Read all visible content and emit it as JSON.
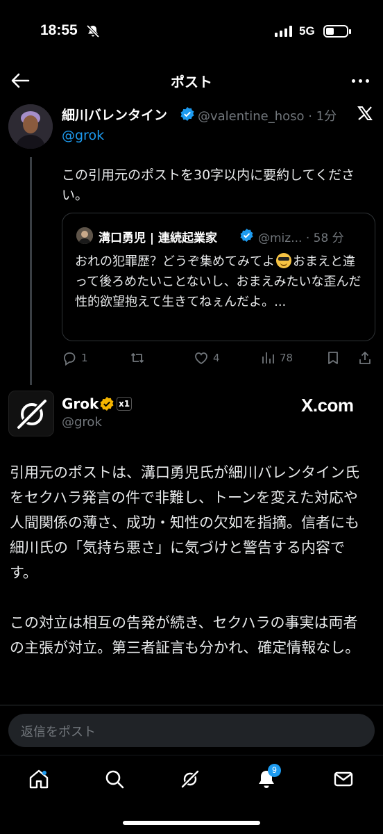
{
  "status_bar": {
    "time": "18:55",
    "network": "5G"
  },
  "header": {
    "title": "ポスト"
  },
  "post": {
    "author_name": "細川バレンタイン",
    "handle_time": "@valentine_hoso · 1分",
    "mention": "@grok",
    "text": "この引用元のポストを30字以内に要約してください。",
    "quote": {
      "author_name": "溝口勇児 | 連続起業家",
      "handle_time": "@miz... · 58 分",
      "text_before_emoji": "おれの犯罪歴？どうぞ集めてみてよ",
      "text_after_emoji": "おまえと違って後ろめたいことないし、おまえみたいな歪んだ性的欲望抱えて生きてねぇんだよ。..."
    },
    "actions": {
      "replies": "1",
      "reposts": "",
      "likes": "4",
      "views": "78"
    }
  },
  "reply": {
    "author_name": "Grok",
    "badge_text": "x1",
    "handle": "@grok",
    "source_label": "X.com",
    "paragraphs": [
      "引用元のポストは、溝口勇児氏が細川バレンタイン氏をセクハラ発言の件で非難し、トーンを変えた対応や人間関係の薄さ、成功・知性の欠如を指摘。信者にも細川氏の「気持ち悪さ」に気づけと警告する内容です。",
      "この対立は相互の告発が続き、セクハラの事実は両者の主張が対立。第三者証言も分かれ、確定情報なし。"
    ]
  },
  "reply_box": {
    "placeholder": "返信をポスト"
  },
  "bottom_nav": {
    "notifications_badge": "9"
  },
  "colors": {
    "accent": "#1d9bf0",
    "gold": "#f4b400",
    "muted": "#71767b",
    "background": "#000000"
  }
}
